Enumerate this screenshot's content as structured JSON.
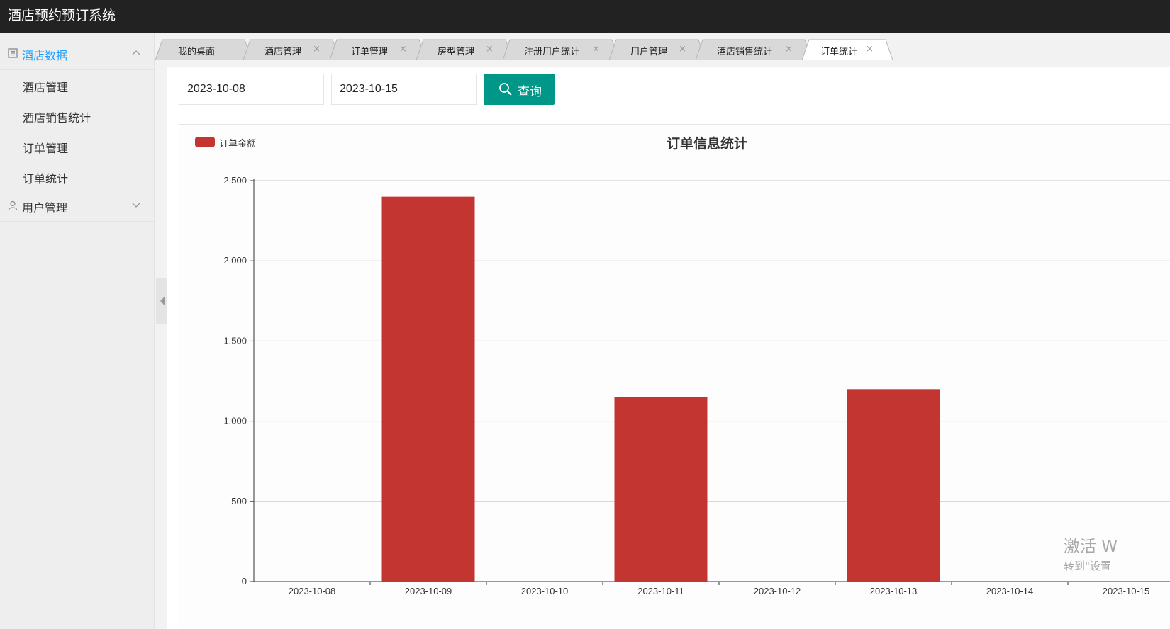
{
  "app": {
    "title": "酒店预约预订系统"
  },
  "sidebar": {
    "groups": [
      {
        "label": "酒店数据",
        "items": [
          "酒店管理",
          "酒店销售统计",
          "订单管理",
          "订单统计"
        ]
      },
      {
        "label": "用户管理"
      }
    ]
  },
  "tabs": [
    "我的桌面",
    "酒店管理",
    "订单管理",
    "房型管理",
    "注册用户统计",
    "用户管理",
    "酒店销售统计",
    "订单统计"
  ],
  "tab_close_glyph": "×",
  "active_tab": "订单统计",
  "filters": {
    "start_date": "2023-10-08",
    "end_date": "2023-10-15",
    "search_label": "查询"
  },
  "colors": {
    "accent": "#009688",
    "active_nav": "#1E9FFF",
    "bar": "#c23531"
  },
  "chart_data": {
    "type": "bar",
    "title": "订单信息统计",
    "legend": "订单金额",
    "legend_position": "top-left",
    "categories": [
      "2023-10-08",
      "2023-10-09",
      "2023-10-10",
      "2023-10-11",
      "2023-10-12",
      "2023-10-13",
      "2023-10-14",
      "2023-10-15"
    ],
    "series": [
      {
        "name": "订单金额",
        "values": [
          0,
          2400,
          0,
          1150,
          0,
          1200,
          0,
          0
        ]
      }
    ],
    "ylim": [
      0,
      2500
    ],
    "yticks": [
      "0",
      "500",
      "1,000",
      "1,500",
      "2,000",
      "2,500"
    ],
    "grid": true
  },
  "watermark": {
    "line1": "激活 W",
    "line2": "转到\"设置"
  }
}
